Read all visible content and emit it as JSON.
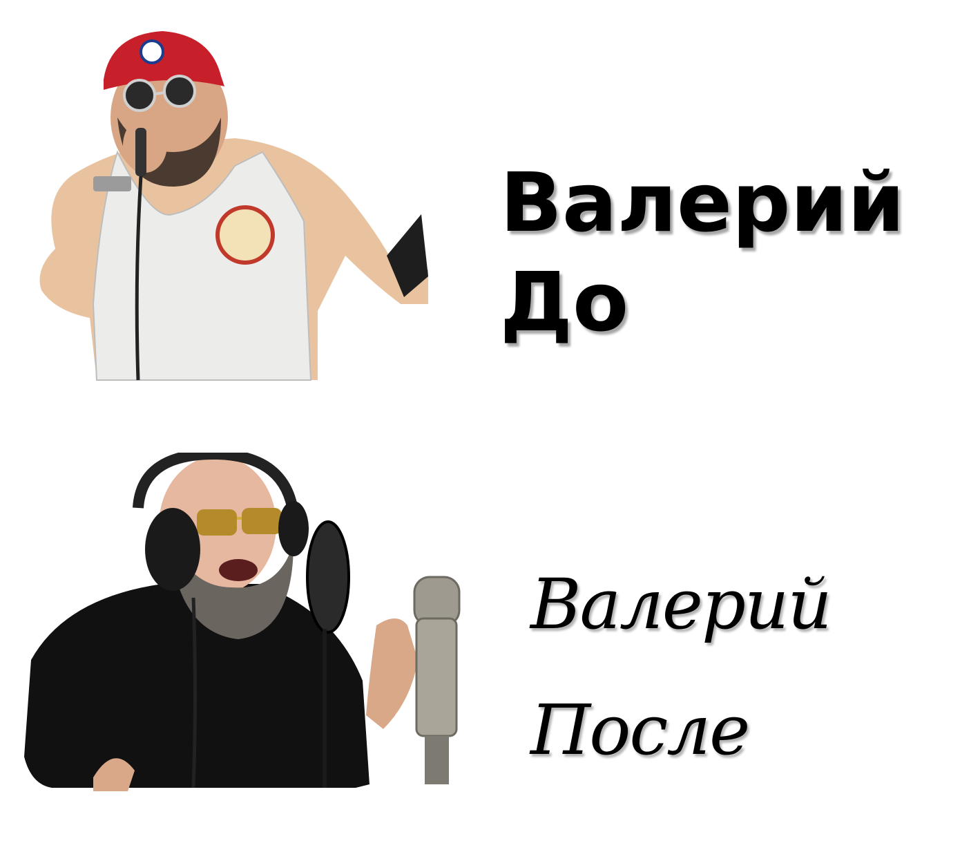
{
  "before": {
    "line1": "Валерий",
    "line2": "До",
    "photo_icon": "singer-in-cap-and-sunglasses-with-microphone-photo"
  },
  "after": {
    "line1": "Валерий",
    "line2": "После",
    "photo_icon": "singer-in-headphones-at-studio-microphone-photo"
  }
}
